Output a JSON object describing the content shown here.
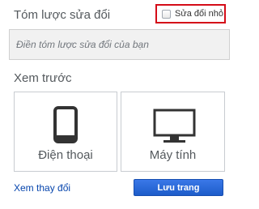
{
  "summary": {
    "title": "Tóm lược sửa đổi",
    "placeholder": "Điền tóm lược sửa đổi của bạn"
  },
  "minor_edit": {
    "label": "Sửa đổi nhỏ",
    "checked": false
  },
  "preview": {
    "heading": "Xem trước",
    "options": [
      {
        "label": "Điện thoại",
        "icon": "phone-icon"
      },
      {
        "label": "Máy tính",
        "icon": "monitor-icon"
      }
    ]
  },
  "actions": {
    "view_changes": "Xem thay đổi",
    "save": "Lưu trang"
  },
  "colors": {
    "highlight_border": "#d40c18",
    "link": "#0645ad",
    "primary_button": "#2a6ad8"
  }
}
